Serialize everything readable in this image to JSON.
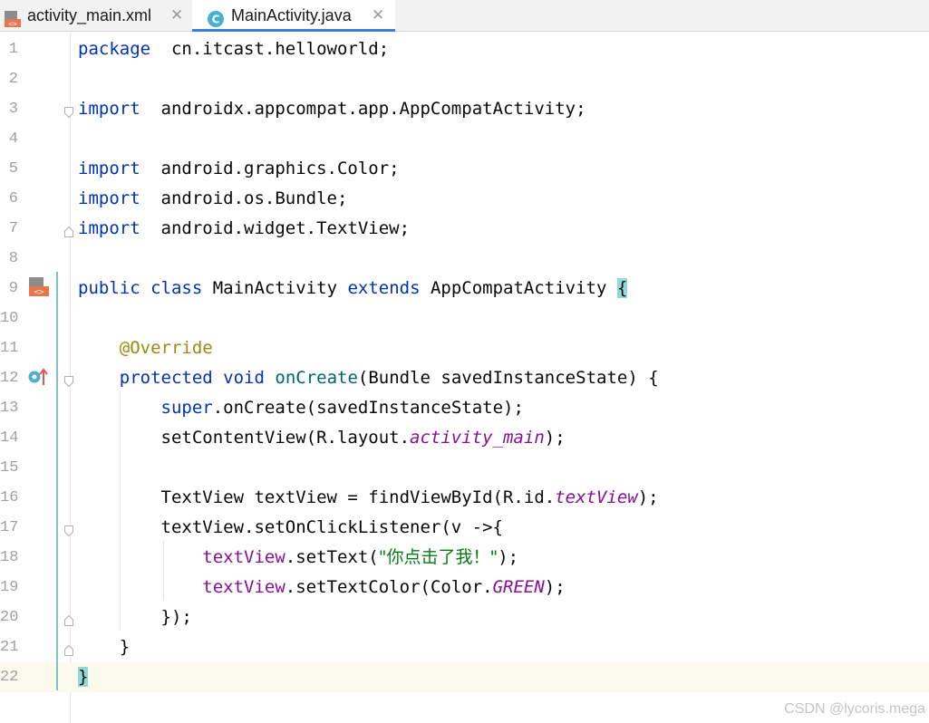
{
  "tabs": [
    {
      "label": "activity_main.xml",
      "icon": "xml-file-icon",
      "active": false
    },
    {
      "label": "MainActivity.java",
      "icon": "java-class-icon",
      "active": true
    }
  ],
  "java_icon_letter": "C",
  "lines": [
    {
      "n": "1",
      "tokens": [
        [
          "kw",
          "package"
        ],
        [
          "",
          "  cn.itcast.helloworld;"
        ]
      ]
    },
    {
      "n": "2",
      "tokens": []
    },
    {
      "n": "3",
      "tokens": [
        [
          "kw",
          "import"
        ],
        [
          "",
          "  androidx.appcompat.app.AppCompatActivity;"
        ]
      ]
    },
    {
      "n": "4",
      "tokens": []
    },
    {
      "n": "5",
      "tokens": [
        [
          "kw",
          "import"
        ],
        [
          "",
          "  android.graphics.Color;"
        ]
      ]
    },
    {
      "n": "6",
      "tokens": [
        [
          "kw",
          "import"
        ],
        [
          "",
          "  android.os.Bundle;"
        ]
      ]
    },
    {
      "n": "7",
      "tokens": [
        [
          "kw",
          "import"
        ],
        [
          "",
          "  android.widget.TextView;"
        ]
      ]
    },
    {
      "n": "8",
      "tokens": []
    },
    {
      "n": "9",
      "tokens": [
        [
          "kw",
          "public"
        ],
        [
          "",
          " "
        ],
        [
          "kw",
          "class"
        ],
        [
          "",
          " MainActivity "
        ],
        [
          "kw",
          "extends"
        ],
        [
          "",
          " AppCompatActivity "
        ],
        [
          "brace-hl",
          "{"
        ]
      ]
    },
    {
      "n": "10",
      "tokens": []
    },
    {
      "n": "11",
      "tokens": [
        [
          "",
          "    "
        ],
        [
          "ann",
          "@Override"
        ]
      ]
    },
    {
      "n": "12",
      "tokens": [
        [
          "",
          "    "
        ],
        [
          "kw",
          "protected"
        ],
        [
          "",
          " "
        ],
        [
          "kw",
          "void"
        ],
        [
          "",
          " "
        ],
        [
          "method",
          "onCreate"
        ],
        [
          "",
          "(Bundle savedInstanceState) {"
        ]
      ]
    },
    {
      "n": "13",
      "tokens": [
        [
          "",
          "        "
        ],
        [
          "kw",
          "super"
        ],
        [
          "",
          ".onCreate(savedInstanceState);"
        ]
      ]
    },
    {
      "n": "14",
      "tokens": [
        [
          "",
          "        setContentView(R.layout."
        ],
        [
          "ifield",
          "activity_main"
        ],
        [
          "",
          ");"
        ]
      ]
    },
    {
      "n": "15",
      "tokens": []
    },
    {
      "n": "16",
      "tokens": [
        [
          "",
          "        TextView textView = findViewById(R.id."
        ],
        [
          "ifield",
          "textView"
        ],
        [
          "",
          ");"
        ]
      ]
    },
    {
      "n": "17",
      "tokens": [
        [
          "",
          "        textView.setOnClickListener(v ->{"
        ]
      ]
    },
    {
      "n": "18",
      "tokens": [
        [
          "",
          "            "
        ],
        [
          "field",
          "textView"
        ],
        [
          "",
          ".setText("
        ],
        [
          "str",
          "\"你点击了我！\""
        ],
        [
          "",
          ");"
        ]
      ]
    },
    {
      "n": "19",
      "tokens": [
        [
          "",
          "            "
        ],
        [
          "field",
          "textView"
        ],
        [
          "",
          ".setTextColor(Color."
        ],
        [
          "ifield",
          "GREEN"
        ],
        [
          "",
          ");"
        ]
      ]
    },
    {
      "n": "20",
      "tokens": [
        [
          "",
          "        });"
        ]
      ]
    },
    {
      "n": "21",
      "tokens": [
        [
          "",
          "    }"
        ]
      ]
    },
    {
      "n": "22",
      "tokens": [
        [
          "brace-hl",
          "}"
        ]
      ]
    }
  ],
  "current_line": "22",
  "watermark": "CSDN @lycoris.mega",
  "colors": {
    "keyword": "#0033b3",
    "annotation": "#9e880d",
    "method": "#00627a",
    "field": "#871094",
    "string": "#067d17",
    "active_tab_underline": "#3f7ddb"
  }
}
